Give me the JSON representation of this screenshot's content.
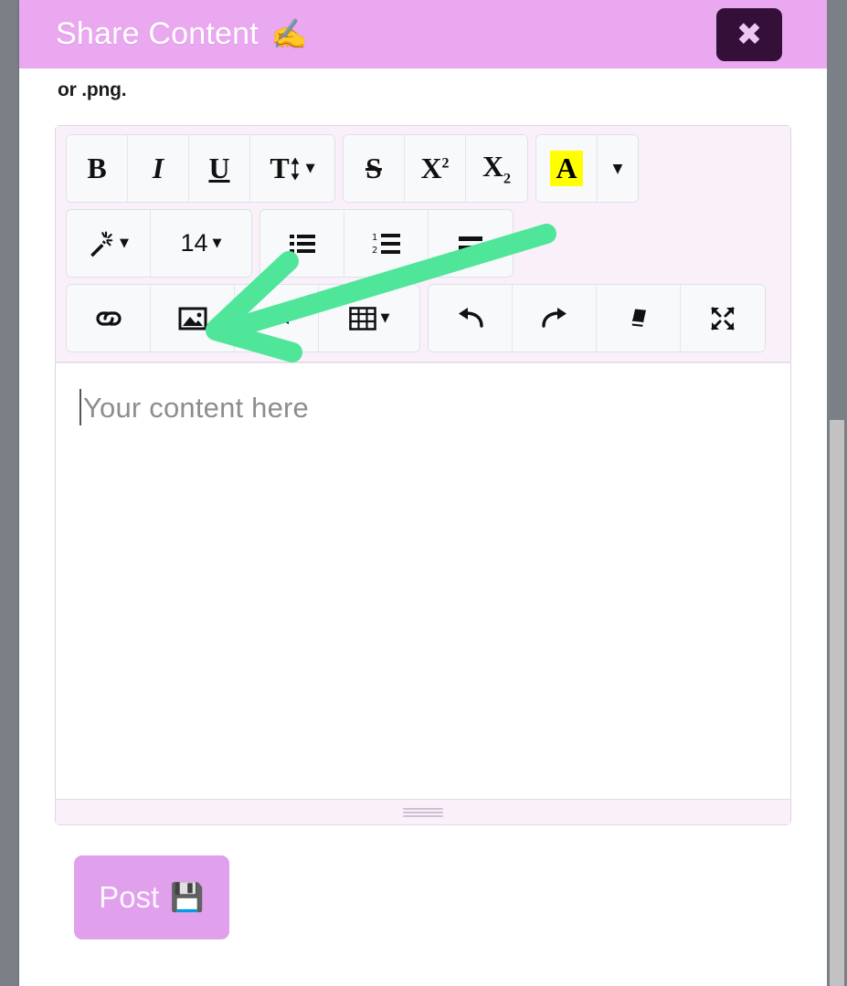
{
  "window": {
    "backdrop_color": "#7b8087",
    "panel_color": "#ffffff"
  },
  "header": {
    "title": "Share Content",
    "title_emoji": "✍️",
    "background_color": "#e9a8ef",
    "title_color": "#ffffff",
    "close_button": {
      "label": "✖",
      "name": "close-icon",
      "background_color": "#341038",
      "icon_color": "#f0c6f4"
    }
  },
  "body": {
    "hint_text": "or .png."
  },
  "editor": {
    "toolbar_background": "#faf0fa",
    "button_background": "#f8f9fb",
    "rows": [
      {
        "groups": [
          {
            "buttons": [
              {
                "name": "bold-button",
                "label": "B",
                "style": "bold"
              },
              {
                "name": "italic-button",
                "label": "I",
                "style": "italic"
              },
              {
                "name": "underline-button",
                "label": "U",
                "style": "underline"
              },
              {
                "name": "line-height-button",
                "label": "T",
                "style": "lineheight",
                "caret": "▼"
              }
            ]
          },
          {
            "buttons": [
              {
                "name": "strikethrough-button",
                "label": "S",
                "style": "strike"
              },
              {
                "name": "superscript-button",
                "label": "X",
                "sup": "2",
                "style": "sup"
              },
              {
                "name": "subscript-button",
                "label": "X",
                "sub": "2",
                "style": "sub"
              }
            ]
          },
          {
            "buttons": [
              {
                "name": "highlight-color-button",
                "label": "A",
                "style": "highlight",
                "highlight_color": "#ffff00"
              },
              {
                "name": "highlight-dropdown-button",
                "label": "▼",
                "style": "caret"
              }
            ]
          }
        ]
      },
      {
        "groups": [
          {
            "buttons": [
              {
                "name": "text-style-button",
                "label": "🪄",
                "style": "icon",
                "caret": "▼"
              },
              {
                "name": "font-size-button",
                "label": "14",
                "style": "size",
                "caret": "▼"
              }
            ]
          },
          {
            "buttons": [
              {
                "name": "bullet-list-button",
                "label": "☰",
                "style": "icon"
              },
              {
                "name": "numbered-list-button",
                "label": "☰",
                "style": "icon"
              },
              {
                "name": "align-button",
                "label": "▬",
                "style": "icon"
              }
            ]
          }
        ]
      },
      {
        "groups": [
          {
            "buttons": [
              {
                "name": "insert-link-button",
                "label": "🔗",
                "style": "icon"
              },
              {
                "name": "insert-image-button",
                "label": "🖼",
                "style": "icon"
              },
              {
                "name": "insert-video-button",
                "label": "▰",
                "style": "icon"
              },
              {
                "name": "insert-table-button",
                "label": "▦",
                "style": "icon",
                "caret": "▼"
              }
            ]
          },
          {
            "buttons": [
              {
                "name": "undo-button",
                "label": "↶",
                "style": "icon"
              },
              {
                "name": "redo-button",
                "label": "↷",
                "style": "icon"
              },
              {
                "name": "clear-formatting-button",
                "label": "▰",
                "style": "icon"
              },
              {
                "name": "fullscreen-button",
                "label": "⤢",
                "style": "icon"
              }
            ]
          }
        ]
      }
    ],
    "content": {
      "placeholder": "Your content here",
      "value": ""
    },
    "resize_handle": "resize-grip"
  },
  "footer": {
    "post_button": {
      "label": "Post",
      "icon": "💾",
      "background_color": "#e0a0ec",
      "text_color": "#fdf6ff"
    }
  },
  "annotation": {
    "arrow_color": "#4fe69a",
    "points_to": "insert-image-button"
  },
  "scrollbar": {
    "track_color": "#7b8087",
    "thumb_color": "#c2c2c2"
  }
}
